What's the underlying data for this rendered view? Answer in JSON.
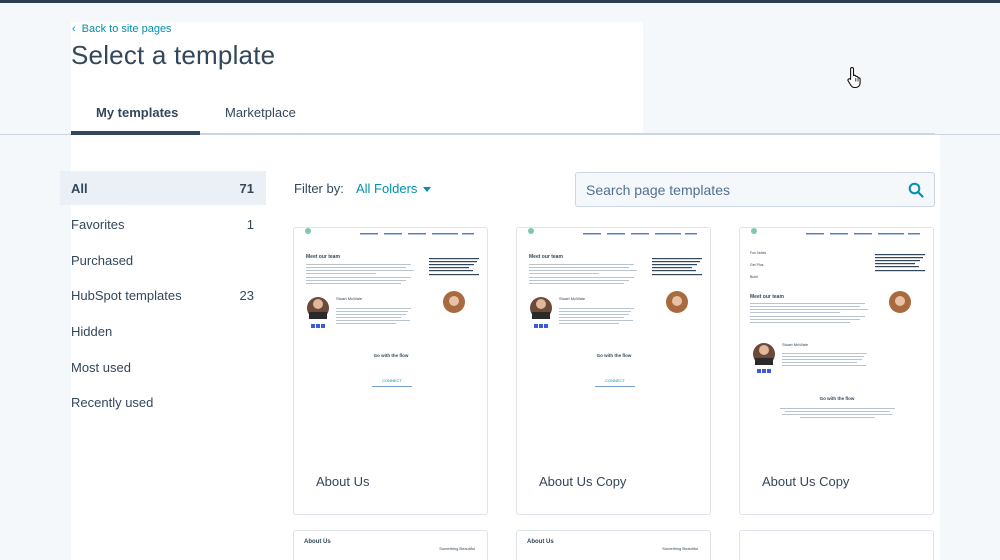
{
  "header": {
    "back_link": "Back to site pages",
    "title": "Select a template",
    "tabs": [
      {
        "label": "My templates",
        "active": true
      },
      {
        "label": "Marketplace",
        "active": false
      }
    ]
  },
  "sidebar": {
    "items": [
      {
        "label": "All",
        "count": "71",
        "active": true
      },
      {
        "label": "Favorites",
        "count": "1"
      },
      {
        "label": "Purchased",
        "count": ""
      },
      {
        "label": "HubSpot templates",
        "count": "23"
      },
      {
        "label": "Hidden",
        "count": ""
      },
      {
        "label": "Most used",
        "count": ""
      },
      {
        "label": "Recently used",
        "count": ""
      }
    ]
  },
  "filter": {
    "label": "Filter by:",
    "value": "All Folders"
  },
  "search": {
    "placeholder": "Search page templates",
    "value": ""
  },
  "templates": [
    {
      "name": "About Us"
    },
    {
      "name": "About Us Copy"
    },
    {
      "name": "About Us Copy"
    }
  ],
  "thumb_text": {
    "heading": "Meet our team",
    "person": "Stuart McWale",
    "flow": "Go with the flow",
    "connect": "CONNECT",
    "about": "About Us",
    "nav1": "Fun Notes",
    "nav2": "Get Plus",
    "nav3": "Build",
    "something": "Something Beautiful"
  },
  "colors": {
    "accent": "#0091ae",
    "text": "#33475b",
    "active_bg": "#eaf0f6",
    "topbar": "#2d3e50"
  }
}
